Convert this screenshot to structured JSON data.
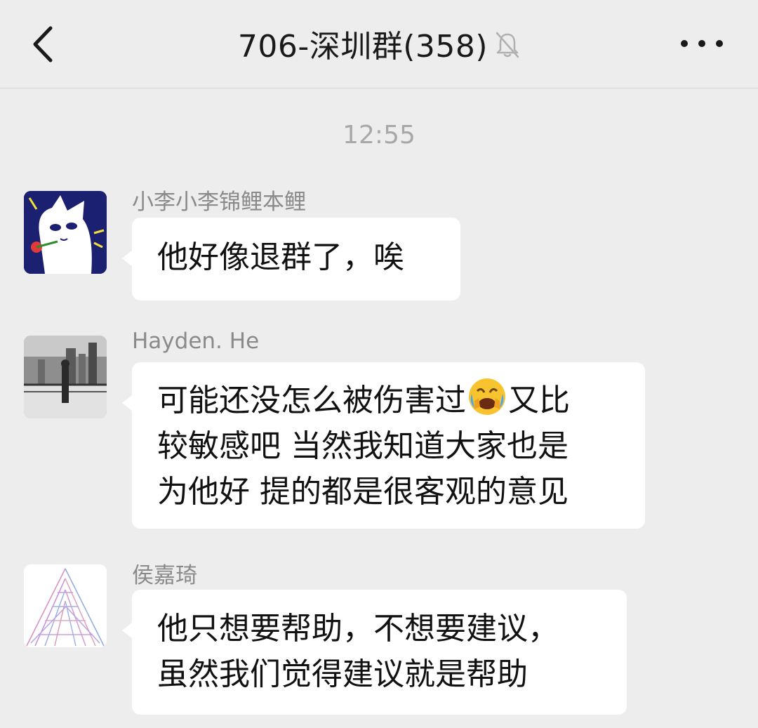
{
  "header": {
    "back_icon": "chevron-left-icon",
    "title": "706-深圳群(358)",
    "mute_icon": "bell-muted-icon",
    "more_icon": "more-dots-icon"
  },
  "timestamp": "12:55",
  "messages": [
    {
      "sender": "小李小李锦鲤本鲤",
      "avatar": "cartoon-cat-avatar",
      "lines": [
        "他好像退群了，唉"
      ]
    },
    {
      "sender": "Hayden. He",
      "avatar": "city-photo-avatar",
      "lines": [
        "可能还没怎么被伤害过",
        "又比",
        "较敏感吧 当然我知道大家也是",
        "为他好 提的都是很客观的意见"
      ],
      "emoji": "face-with-tears-emoji"
    },
    {
      "sender": "侯嘉琦",
      "avatar": "pattern-triangle-avatar",
      "lines": [
        "他只想要帮助，不想要建议，",
        "虽然我们觉得建议就是帮助"
      ]
    }
  ],
  "colors": {
    "background": "#ededed",
    "bubble": "#ffffff",
    "sender_text": "#8a8a8a",
    "timestamp_text": "#a8a8a8"
  }
}
